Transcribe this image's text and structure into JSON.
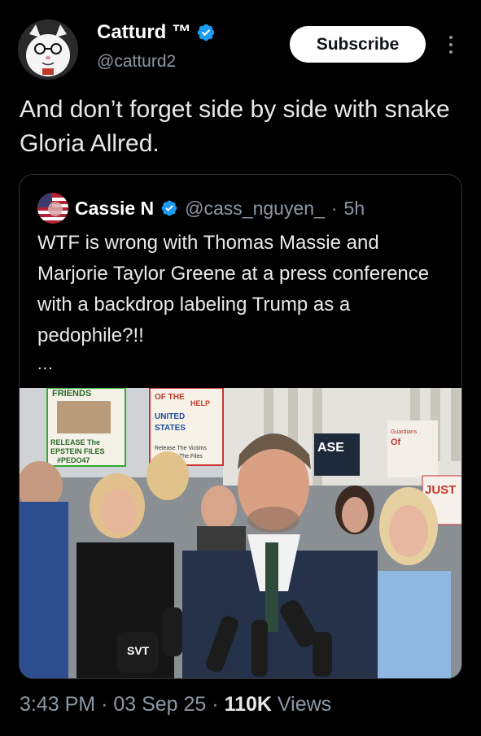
{
  "author": {
    "display_name": "Catturd ™",
    "handle": "@catturd2"
  },
  "actions": {
    "subscribe_label": "Subscribe"
  },
  "tweet": {
    "text": "And don’t forget side by side with snake Gloria Allred."
  },
  "quoted_tweet": {
    "display_name": "Cassie N",
    "handle": "@cass_nguyen_",
    "separator": "·",
    "age": "5h",
    "text": "WTF is wrong with Thomas Massie and Marjorie Taylor Greene at a press conference with a backdrop labeling Trump as a pedophile?!!",
    "ellipsis": "...",
    "media": {
      "signs": {
        "friends": "FRIENDS",
        "release": "RELEASE The",
        "epstein": "EPSTEIN FILES",
        "pedo": "#PEDO47",
        "of_the": "OF THE",
        "united": "UNITED",
        "states": "STATES",
        "help": "HELP",
        "victims": "Release The Victims",
        "files": "The Files",
        "release_right": "ASE",
        "guardians": "Guardians",
        "of": "Of",
        "justice": "JUST"
      },
      "mic_label": "SVT"
    }
  },
  "footer": {
    "time": "3:43 PM",
    "dot": "·",
    "date": "03 Sep 25",
    "views_count": "110K",
    "views_label": "Views"
  },
  "colors": {
    "background": "#000000",
    "verified_blue": "#1d9bf0",
    "secondary_text": "#8b98a5",
    "border": "#2f3336"
  }
}
